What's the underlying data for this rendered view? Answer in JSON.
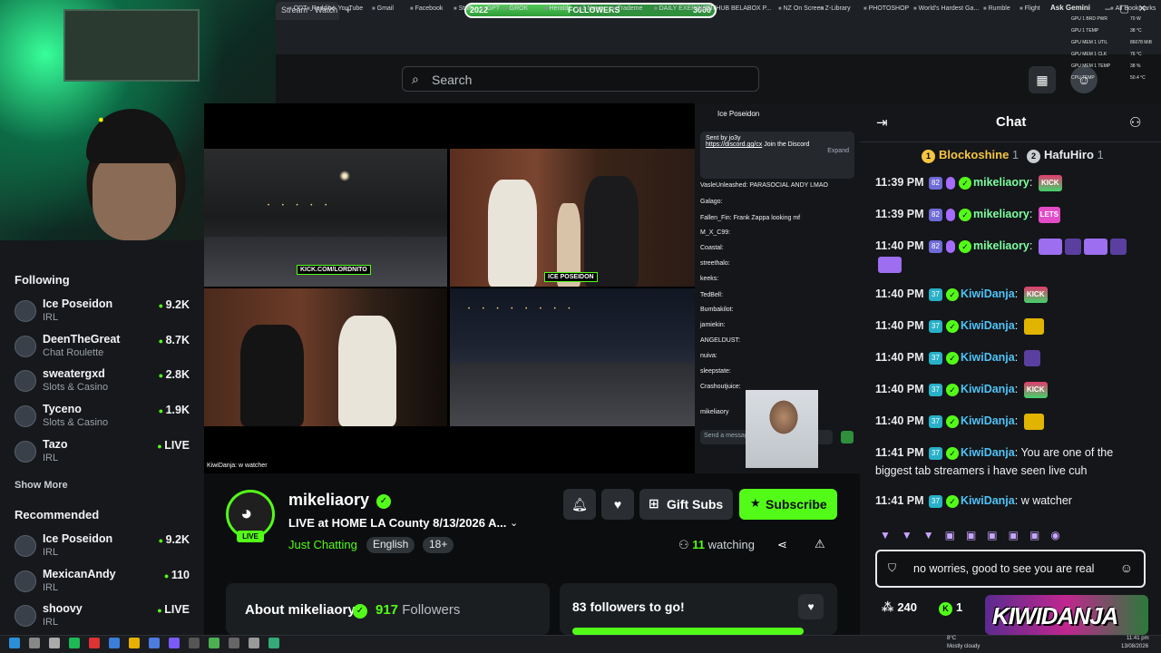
{
  "browser": {
    "active_tab_title": "Stream - Watch",
    "followers_goal": {
      "min": "2022",
      "label": "FOLLOWERS",
      "max": "3000",
      "progress": 0.42
    },
    "ask_label": "Ask Gemini",
    "bookmarks": [
      "ODT",
      "Reddit",
      "YouTube",
      "Gmail",
      "Facebook",
      "Stuff",
      "GPT",
      "GROK",
      "Herald",
      "3 News",
      "Trademe",
      "DAILY EXERCISE!",
      "GITHUB BELABOX P...",
      "NZ On Screen",
      "Z-Library",
      "PHOTOSHOP",
      "World's Hardest Ga...",
      "Rumble",
      "Flight",
      "All Bookmarks"
    ]
  },
  "hw_monitor": {
    "labels": [
      "GPU 1 BRD PWR",
      "GPU 1 TEMP",
      "GPU MEM 1 UTIL",
      "GPU MEM 1 CLK",
      "GPU MEM 1 TEMP",
      "CPU TEMP"
    ],
    "values": [
      "70 W",
      "38 °C",
      "86078 MiB",
      "76 °C",
      "38 %",
      "50.4 °C"
    ]
  },
  "search": {
    "placeholder": "Search"
  },
  "sidebar": {
    "following_heading": "Following",
    "following": [
      {
        "name": "Ice Poseidon",
        "category": "IRL",
        "viewers": "9.2K"
      },
      {
        "name": "DeenTheGreat",
        "category": "Chat Roulette",
        "viewers": "8.7K"
      },
      {
        "name": "sweatergxd",
        "category": "Slots & Casino",
        "viewers": "2.8K"
      },
      {
        "name": "Tyceno",
        "category": "Slots & Casino",
        "viewers": "1.9K"
      },
      {
        "name": "Tazo",
        "category": "IRL",
        "viewers": "LIVE"
      }
    ],
    "show_more": "Show More",
    "recommended_heading": "Recommended",
    "recommended": [
      {
        "name": "Ice Poseidon",
        "category": "IRL",
        "viewers": "9.2K"
      },
      {
        "name": "MexicanAndy",
        "category": "IRL",
        "viewers": "110"
      },
      {
        "name": "shoovy",
        "category": "IRL",
        "viewers": "LIVE"
      }
    ]
  },
  "player": {
    "kick_tags": [
      "KICK.COM/LORDNITO",
      "ICE POSEIDON"
    ],
    "caption": "KiwiDanja: w watcher",
    "embedded_chat": {
      "channel": "Ice Poseidon",
      "pin_sender": "Sent by jo3y",
      "pin_link": "https://discord.gg/cx",
      "pin_text": "Join the Discord",
      "pin_expand": "Expand",
      "rows": [
        "VasleUnleashed: PARASOCIAL ANDY LMAO",
        "Galago:",
        "Fallen_Fin: Frank Zappa looking mf",
        "M_X_C99:",
        "Coastal:",
        "streethalo:",
        "keeks:",
        "TedBell:",
        "Bumbakilot:",
        "jamiekin:",
        "ANGELDUST:",
        "nuiva:",
        "sleepstate:",
        "Crashoutjuice:"
      ],
      "viewer_name": "mikeliaory",
      "input_placeholder": "Send a message"
    }
  },
  "channel": {
    "name": "mikeliaory",
    "live_badge": "LIVE",
    "title": "LIVE at HOME LA County 8/13/2026 A...",
    "category": "Just Chatting",
    "tags": [
      "English",
      "18+"
    ],
    "gift_subs_label": "Gift Subs",
    "subscribe_label": "Subscribe",
    "watching_count": "11",
    "watching_label": "watching"
  },
  "about": {
    "title": "About mikeliaory",
    "followers_count": "917",
    "followers_label": "Followers"
  },
  "goal": {
    "title": "83 followers to go!",
    "progress": 0.92
  },
  "chat": {
    "title": "Chat",
    "top_gifters": [
      {
        "rank": "1",
        "name": "Blockoshine",
        "count": "1"
      },
      {
        "rank": "2",
        "name": "HafuHiro",
        "count": "1"
      }
    ],
    "messages": [
      {
        "time": "11:39 PM",
        "badge": "82",
        "user": "mikeliaory",
        "text": "",
        "emotes": [
          "KICK"
        ]
      },
      {
        "time": "11:39 PM",
        "badge": "82",
        "user": "mikeliaory",
        "text": "",
        "emotes": [
          "LETS"
        ]
      },
      {
        "time": "11:40 PM",
        "badge": "82",
        "user": "mikeliaory",
        "text": "",
        "emotes": [
          "cat",
          "leaf",
          "cat",
          "leaf",
          "cat"
        ]
      },
      {
        "time": "11:40 PM",
        "badge": "37",
        "user": "KiwiDanja",
        "text": "",
        "emotes": [
          "KICK"
        ]
      },
      {
        "time": "11:40 PM",
        "badge": "37",
        "user": "KiwiDanja",
        "text": "",
        "emotes": [
          "wu"
        ]
      },
      {
        "time": "11:40 PM",
        "badge": "37",
        "user": "KiwiDanja",
        "text": "",
        "emotes": [
          "leaf"
        ]
      },
      {
        "time": "11:40 PM",
        "badge": "37",
        "user": "KiwiDanja",
        "text": "",
        "emotes": [
          "KICK"
        ]
      },
      {
        "time": "11:40 PM",
        "badge": "37",
        "user": "KiwiDanja",
        "text": "",
        "emotes": [
          "wu"
        ]
      },
      {
        "time": "11:41 PM",
        "badge": "37",
        "user": "KiwiDanja",
        "text": "You are one of the biggest tab streamers i have seen live cuh",
        "emotes": []
      },
      {
        "time": "11:41 PM",
        "badge": "37",
        "user": "KiwiDanja",
        "text": "w watcher",
        "emotes": []
      }
    ],
    "input_value": "no worries, good to see you are real",
    "points": "240",
    "kick_points": "1"
  },
  "brand_logo_text": "KIWIDANJA",
  "taskbar": {
    "weather_temp": "8°C",
    "weather_text": "Mostly cloudy",
    "time": "11:41 pm",
    "date": "13/08/2026"
  },
  "colors": {
    "kick_green": "#53fc18",
    "background": "#0b0d0e",
    "panel": "#1b1e21"
  }
}
